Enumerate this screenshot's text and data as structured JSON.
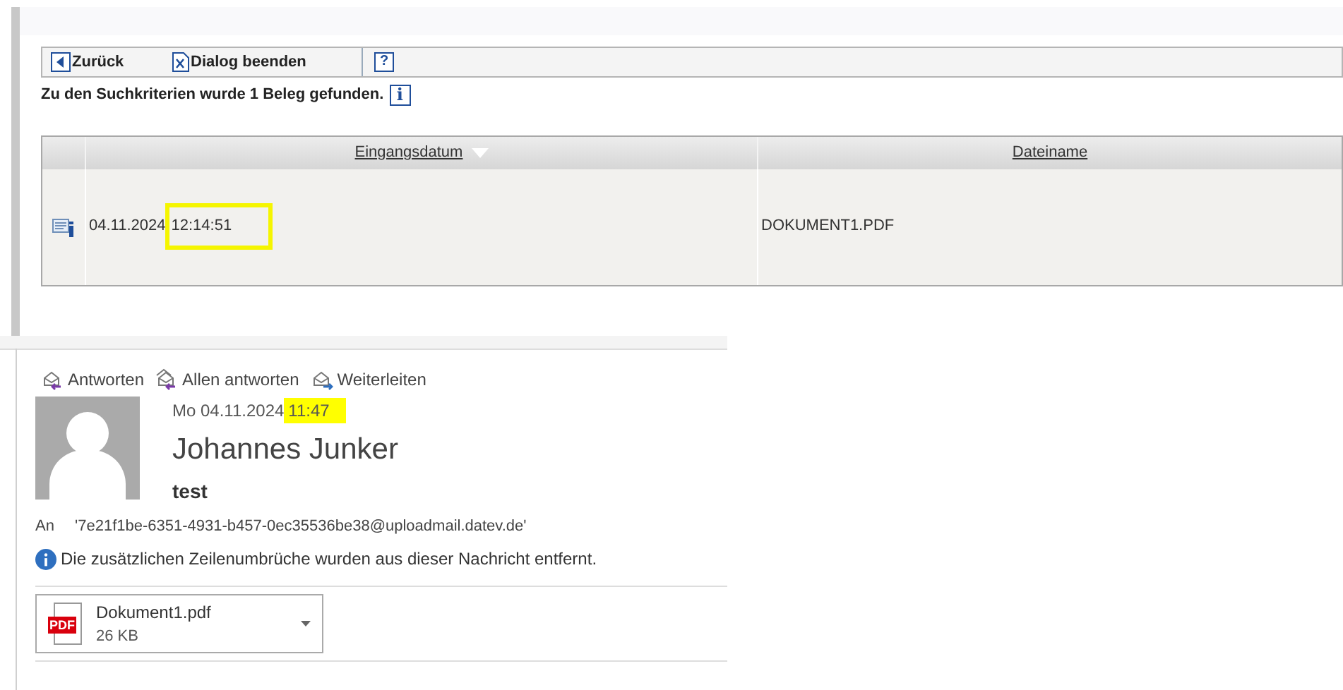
{
  "search_dialog": {
    "toolbar": [
      {
        "kind": "back",
        "label": "Zurück"
      },
      {
        "kind": "close",
        "label": "Dialog beenden"
      },
      {
        "kind": "help",
        "label": "?"
      }
    ],
    "result_message": "Zu den Suchkriterien wurde 1 Beleg gefunden.",
    "info_icon_label": "i",
    "table": {
      "columns": [
        {
          "label": "Eingangsdatum",
          "sorted": true
        },
        {
          "label": "Dateiname",
          "sorted": false
        }
      ],
      "rows": [
        {
          "date": "04.11.2024",
          "time": "12:14:51",
          "time_highlighted": true,
          "filename": "DOKUMENT1.PDF"
        }
      ]
    }
  },
  "mail": {
    "actions": [
      {
        "kind": "reply",
        "label": "Antworten"
      },
      {
        "kind": "reply_all",
        "label": "Allen antworten"
      },
      {
        "kind": "forward",
        "label": "Weiterleiten"
      }
    ],
    "date": "Mo 04.11.2024",
    "time": "11:47",
    "time_highlighted": true,
    "sender": "Johannes Junker",
    "subject": "test",
    "to_label": "An",
    "to": "'7e21f1be-6351-4931-b457-0ec35536be38@uploadmail.datev.de'",
    "notice": "Die zusätzlichen Zeilenumbrüche wurden aus dieser Nachricht entfernt.",
    "attachments": [
      {
        "icon_label": "PDF",
        "name": "Dokument1.pdf",
        "size": "26 KB"
      }
    ]
  }
}
